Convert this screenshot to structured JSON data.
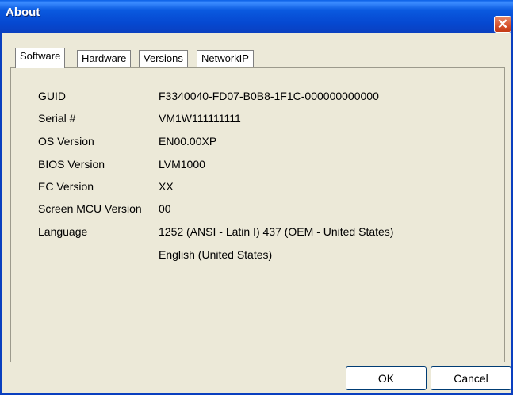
{
  "window": {
    "title": "About",
    "close_symbol": "✕"
  },
  "tabs": [
    {
      "label": "Software",
      "active": true
    },
    {
      "label": "Hardware",
      "active": false
    },
    {
      "label": "Versions",
      "active": false
    },
    {
      "label": "NetworkIP",
      "active": false
    }
  ],
  "info": [
    {
      "label": "GUID",
      "value": "F3340040-FD07-B0B8-1F1C-000000000000"
    },
    {
      "label": "Serial #",
      "value": "VM1W111111111"
    },
    {
      "label": "OS Version",
      "value": "EN00.00XP"
    },
    {
      "label": "BIOS Version",
      "value": "LVM1000"
    },
    {
      "label": "EC Version",
      "value": "XX"
    },
    {
      "label": "Screen MCU Version",
      "value": "00"
    },
    {
      "label": "Language",
      "value": "1252  (ANSI - Latin I) 437   (OEM - United States)"
    },
    {
      "label": "",
      "value": "English (United States)"
    }
  ],
  "buttons": {
    "ok": "OK",
    "cancel": "Cancel"
  },
  "colors": {
    "titlebar": "#0a5ae0",
    "dialog_bg": "#ece9d8",
    "close_button": "#d6522c"
  }
}
